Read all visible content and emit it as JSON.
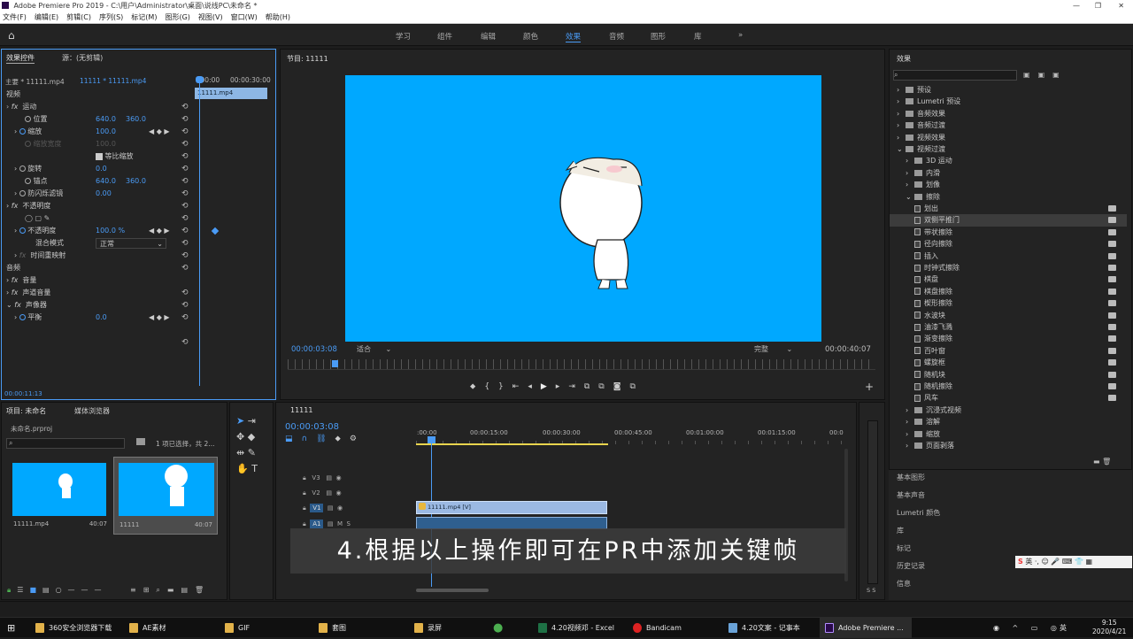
{
  "window": {
    "title": "Adobe Premiere Pro 2019 - C:\\用户\\Administrator\\桌面\\说线PC\\未命名 *",
    "controls": [
      "—",
      "❐",
      "✕"
    ]
  },
  "menu": [
    "文件(F)",
    "编辑(E)",
    "剪辑(C)",
    "序列(S)",
    "标记(M)",
    "图形(G)",
    "视图(V)",
    "窗口(W)",
    "帮助(H)"
  ],
  "workspaces": [
    "学习",
    "组件",
    "编辑",
    "颜色",
    "效果",
    "音频",
    "图形",
    "库",
    "»"
  ],
  "active_workspace": "效果",
  "effect_controls": {
    "tab": "效果控件",
    "source_tab": "源：(无剪辑)",
    "clip": "主要 * 11111.mp4",
    "seq": "11111 * 11111.mp4",
    "ruler_start": ":00:00",
    "ruler_end": "00:00:30:00",
    "clip_bar": "11111.mp4",
    "video_hdr": "视频",
    "motion": "运动",
    "position": "位置",
    "pos_x": "640.0",
    "pos_y": "360.0",
    "scale": "缩放",
    "scale_v": "100.0",
    "scale_w": "缩放宽度",
    "scale_w_v": "100.0",
    "uniform": "等比缩放",
    "rotation": "旋转",
    "rotation_v": "0.0",
    "anchor": "锚点",
    "anc_x": "640.0",
    "anc_y": "360.0",
    "flicker": "防闪烁滤镜",
    "flicker_v": "0.00",
    "opacity_hdr": "不透明度",
    "opacity": "不透明度",
    "opacity_v": "100.0 %",
    "blend": "混合模式",
    "blend_v": "正常",
    "timeremap": "时间重映射",
    "audio_hdr": "音频",
    "volume": "音量",
    "channel": "声道音量",
    "panner": "声像器",
    "balance": "平衡",
    "balance_v": "0.0",
    "timecode": "00:00:11:13"
  },
  "program": {
    "title": "节目: 11111",
    "timecode": "00:00:03:08",
    "fit": "适合",
    "quality": "完整",
    "duration": "00:00:40:07",
    "playhead_fraction": 0.08
  },
  "project": {
    "tab": "项目: 未命名",
    "media_tab": "媒体浏览器",
    "file": "未命名.prproj",
    "selection": "1 项已选择，共 2...",
    "items": [
      {
        "name": "11111.mp4",
        "dur": "40:07"
      },
      {
        "name": "11111",
        "dur": "40:07"
      }
    ]
  },
  "timeline": {
    "seq": "11111",
    "timecode": "00:00:03:08",
    "ticks": [
      ":00:00",
      "00:00:15:00",
      "00:00:30:00",
      "00:00:45:00",
      "00:01:00:00",
      "00:01:15:00",
      "00:0"
    ],
    "tracks": [
      "V3",
      "V2",
      "V1",
      "A1"
    ],
    "clip": "11111.mp4 [V]",
    "zoom_label": "S S"
  },
  "effects": {
    "title": "效果",
    "tree": [
      {
        "t": "预设",
        "lvl": 0,
        "k": "folder",
        "open": false
      },
      {
        "t": "Lumetri 预设",
        "lvl": 0,
        "k": "folder",
        "open": false
      },
      {
        "t": "音频效果",
        "lvl": 0,
        "k": "folder",
        "open": false
      },
      {
        "t": "音频过渡",
        "lvl": 0,
        "k": "folder",
        "open": false
      },
      {
        "t": "视频效果",
        "lvl": 0,
        "k": "folder",
        "open": false
      },
      {
        "t": "视频过渡",
        "lvl": 0,
        "k": "folder",
        "open": true
      },
      {
        "t": "3D 运动",
        "lvl": 1,
        "k": "folder",
        "open": false
      },
      {
        "t": "内滑",
        "lvl": 1,
        "k": "folder",
        "open": false
      },
      {
        "t": "划像",
        "lvl": 1,
        "k": "folder",
        "open": false
      },
      {
        "t": "擦除",
        "lvl": 1,
        "k": "folder",
        "open": true
      },
      {
        "t": "划出",
        "lvl": 2,
        "k": "doc"
      },
      {
        "t": "双侧平推门",
        "lvl": 2,
        "k": "doc",
        "sel": true
      },
      {
        "t": "带状擦除",
        "lvl": 2,
        "k": "doc"
      },
      {
        "t": "径向擦除",
        "lvl": 2,
        "k": "doc"
      },
      {
        "t": "插入",
        "lvl": 2,
        "k": "doc"
      },
      {
        "t": "时钟式擦除",
        "lvl": 2,
        "k": "doc"
      },
      {
        "t": "棋盘",
        "lvl": 2,
        "k": "doc"
      },
      {
        "t": "棋盘擦除",
        "lvl": 2,
        "k": "doc"
      },
      {
        "t": "楔形擦除",
        "lvl": 2,
        "k": "doc"
      },
      {
        "t": "水波块",
        "lvl": 2,
        "k": "doc"
      },
      {
        "t": "油漆飞溅",
        "lvl": 2,
        "k": "doc"
      },
      {
        "t": "渐变擦除",
        "lvl": 2,
        "k": "doc"
      },
      {
        "t": "百叶窗",
        "lvl": 2,
        "k": "doc"
      },
      {
        "t": "螺旋框",
        "lvl": 2,
        "k": "doc"
      },
      {
        "t": "随机块",
        "lvl": 2,
        "k": "doc"
      },
      {
        "t": "随机擦除",
        "lvl": 2,
        "k": "doc"
      },
      {
        "t": "风车",
        "lvl": 2,
        "k": "doc"
      },
      {
        "t": "沉浸式视频",
        "lvl": 1,
        "k": "folder",
        "open": false
      },
      {
        "t": "溶解",
        "lvl": 1,
        "k": "folder",
        "open": false
      },
      {
        "t": "缩放",
        "lvl": 1,
        "k": "folder",
        "open": false
      },
      {
        "t": "页面剥落",
        "lvl": 1,
        "k": "folder",
        "open": false
      }
    ],
    "panels": [
      "基本图形",
      "基本声音",
      "Lumetri 颜色",
      "库",
      "标记",
      "历史记录",
      "信息"
    ]
  },
  "subtitle": "4.根据以上操作即可在PR中添加关键帧",
  "taskbar": {
    "items": [
      "360安全浏览器下载",
      "AE素材",
      "GIF",
      "套图",
      "录屏",
      "4.20视频邓 - Excel",
      "Bandicam",
      "4.20文案 - 记事本",
      "Adobe Premiere ..."
    ],
    "ime": "英",
    "time": "9:15",
    "date": "2020/4/21",
    "ime_tray": "英"
  },
  "colors": {
    "accent": "#4a9bf5",
    "video_bg": "#00a8ff"
  }
}
